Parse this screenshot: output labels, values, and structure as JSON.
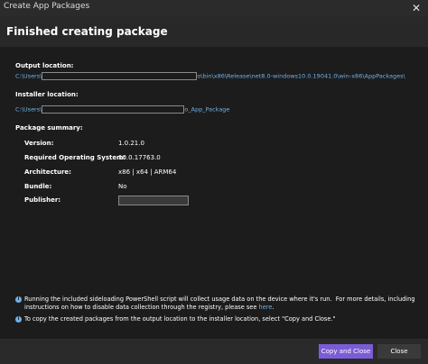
{
  "window": {
    "title": "Create App Packages",
    "close_glyph": "✕"
  },
  "header": {
    "title": "Finished creating package"
  },
  "output": {
    "label": "Output location:",
    "prefix": "C:\\Users\\",
    "suffix": "o\\bin\\x86\\Release\\net8.0-windows10.0.19041.0\\win-x86\\AppPackages\\"
  },
  "installer": {
    "label": "Installer location:",
    "prefix": "C:\\Users\\",
    "suffix": "o_App_Package"
  },
  "summary": {
    "label": "Package summary:",
    "version_k": "Version:",
    "version_v": "1.0.21.0",
    "os_k": "Required Operating System:",
    "os_v": "10.0.17763.0",
    "arch_k": "Architecture:",
    "arch_v": "x86 | x64 | ARM64",
    "bundle_k": "Bundle:",
    "bundle_v": "No",
    "publisher_k": "Publisher:"
  },
  "notes": {
    "info_icon": "info-icon",
    "line1a": "Running the included sideloading PowerShell script will collect usage data on the device where it's run.  For more details, including",
    "line1b": "instructions on how to disable data collection through the registry, please see ",
    "link": "here",
    "line2": "To copy the created packages from the output location to the installer location, select \"Copy and Close.\""
  },
  "footer": {
    "copy_close": "Copy and Close",
    "close": "Close"
  },
  "colors": {
    "accent": "#7b5cd6",
    "link": "#6fb1e8",
    "background": "#1c1c1c"
  }
}
